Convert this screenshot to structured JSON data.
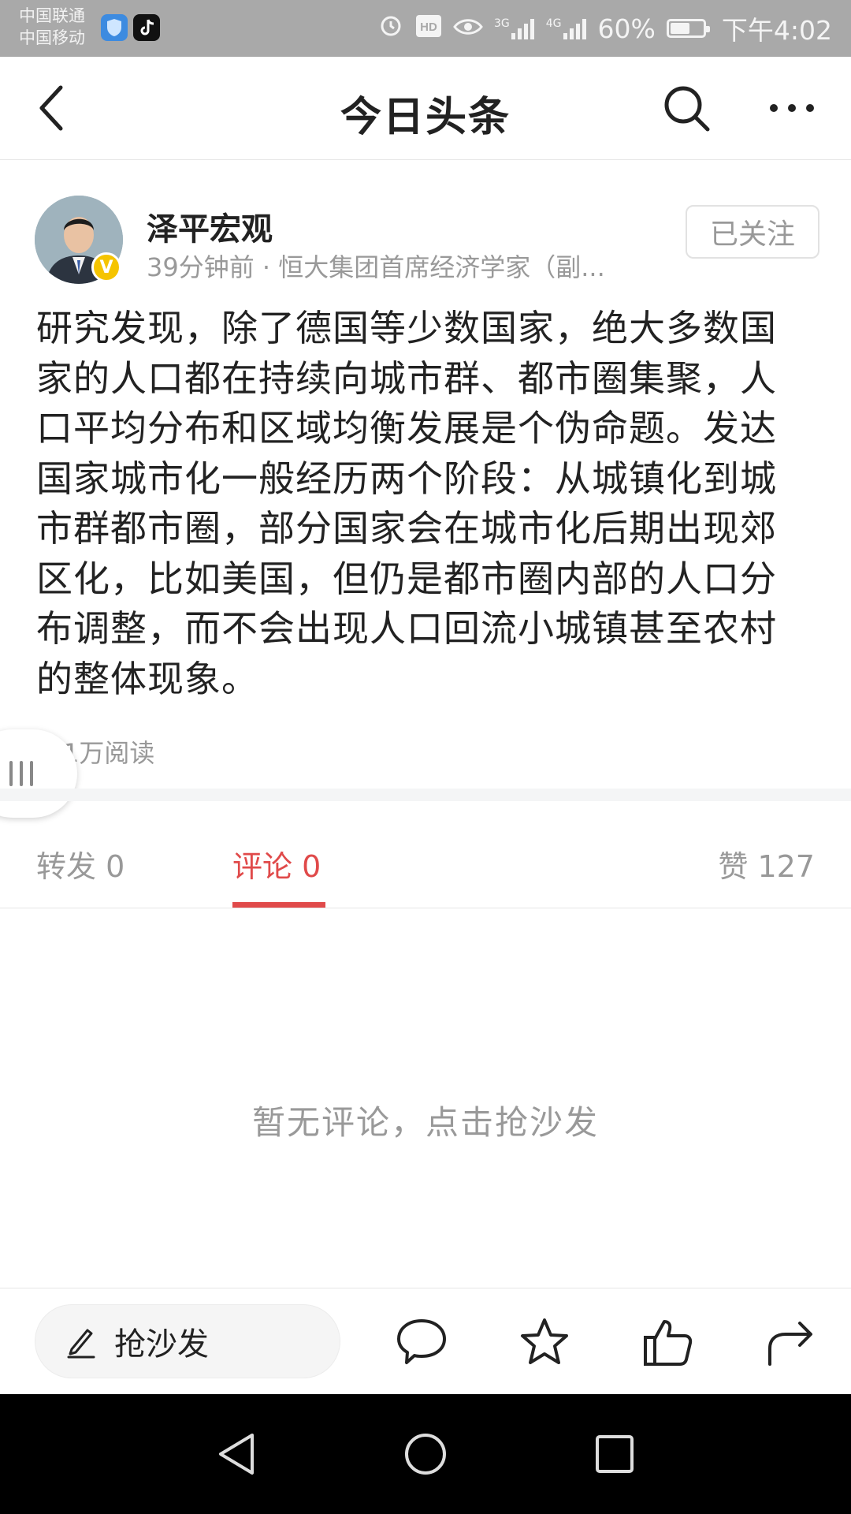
{
  "status_bar": {
    "carrier_1": "中国联通",
    "carrier_2": "中国移动",
    "network_1": "3G",
    "network_2": "4G",
    "battery_percent_text": "60%",
    "battery_level": 0.6,
    "time": "下午4:02",
    "bg_color": "#a9a9a9",
    "icons": [
      "shield-app-icon",
      "tiktok-app-icon",
      "alarm-icon",
      "hd-icon",
      "eye-icon",
      "signal-icon",
      "battery-icon"
    ]
  },
  "nav": {
    "title": "今日头条",
    "icons": [
      "back-icon",
      "search-icon",
      "more-icon"
    ]
  },
  "author": {
    "name": "泽平宏观",
    "verified_badge": "V",
    "meta": "39分钟前 · 恒大集团首席经济学家（副...",
    "follow_label": "已关注"
  },
  "post": {
    "text": "研究发现，除了德国等少数国家，绝大多数国家的人口都在持续向城市群、都市圈集聚，人口平均分布和区域均衡发展是个伪命题。发达国家城市化一般经历两个阶段：从城镇化到城市群都市圈，部分国家会在城市化后期出现郊区化，比如美国，但仍是都市圈内部的人口分布调整，而不会出现人口回流小城镇甚至农村的整体现象。",
    "read_count": "1万阅读"
  },
  "tabs": {
    "repost": "转发 0",
    "comments": "评论 0",
    "likes": "赞 127",
    "active_color": "#e04a4a"
  },
  "comments": {
    "empty_text": "暂无评论，点击抢沙发"
  },
  "bottom_bar": {
    "input_label": "抢沙发",
    "icons": [
      "pen-icon",
      "comment-icon",
      "star-icon",
      "thumbs-up-icon",
      "share-icon"
    ]
  },
  "system_nav": {
    "icons": [
      "nav-back-icon",
      "nav-home-icon",
      "nav-recents-icon"
    ]
  }
}
